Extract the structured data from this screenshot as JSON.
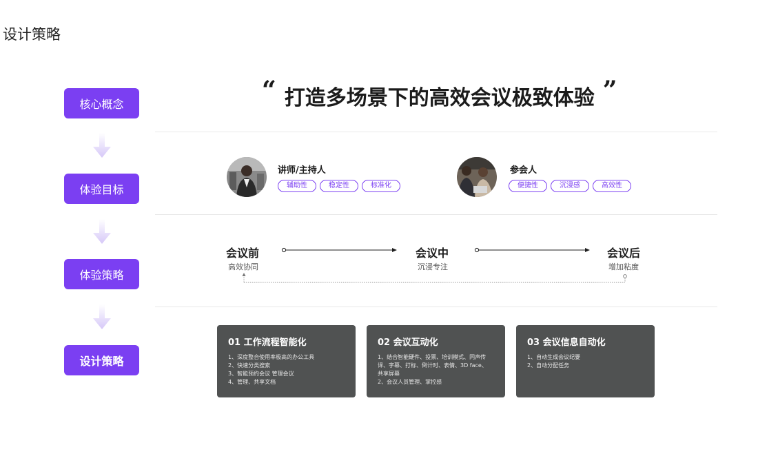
{
  "page_title": "设计策略",
  "flow_steps": [
    "核心概念",
    "体验目标",
    "体验策略",
    "设计策略"
  ],
  "headline": {
    "open_quote": "“",
    "text": "打造多场景下的高效会议极致体验",
    "close_quote": "”"
  },
  "personas": [
    {
      "name": "讲师/主持人",
      "tags": [
        "辅助性",
        "稳定性",
        "标准化"
      ]
    },
    {
      "name": "参会人",
      "tags": [
        "便捷性",
        "沉浸感",
        "高效性"
      ]
    }
  ],
  "stages": [
    {
      "name": "会议前",
      "sub": "高效协同"
    },
    {
      "name": "会议中",
      "sub": "沉浸专注"
    },
    {
      "name": "会议后",
      "sub": "增加粘度"
    }
  ],
  "cards": [
    {
      "title": "01 工作流程智能化",
      "lines": [
        "1、深度整合使用率极高的办公工具",
        "2、快速分类搜索",
        "3、智能预约会议 管理会议",
        "4、管理、共享文档"
      ]
    },
    {
      "title": "02 会议互动化",
      "lines": [
        "1、结合智能硬件、投票、培训模式、同声传",
        "译、字幕、打标、倒计时、表情、3D face、",
        "共享屏幕",
        "2、会议人员管理、掌控感"
      ]
    },
    {
      "title": "03 会议信息自动化",
      "lines": [
        "1、自动生成会议纪要",
        "2、自动分配任务"
      ]
    }
  ],
  "colors": {
    "accent": "#7b3ff2",
    "card_bg": "#505252",
    "arrow": "#d9cdf7"
  }
}
